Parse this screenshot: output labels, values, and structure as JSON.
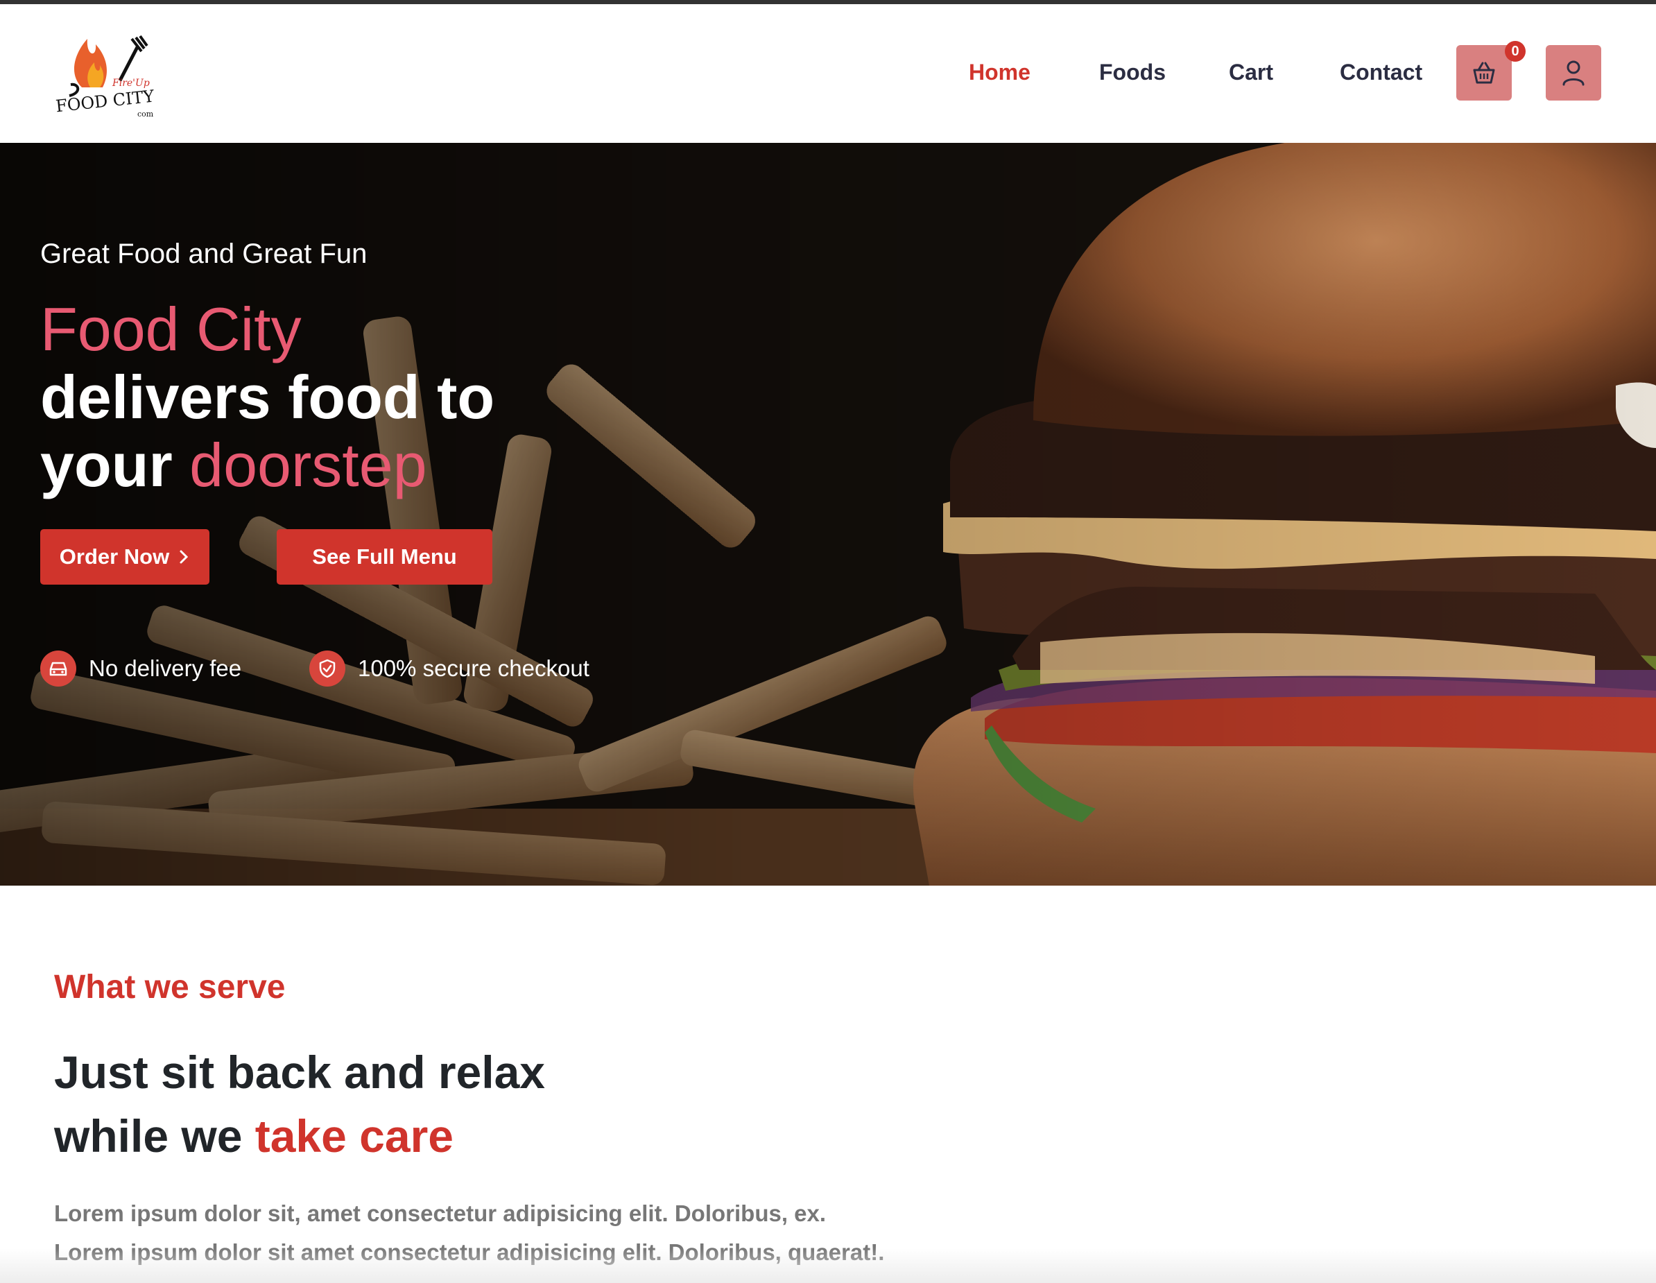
{
  "brand": {
    "logo_top": "Fire'Up",
    "logo_main": "FOOD CITY",
    "logo_sub": "com"
  },
  "nav": {
    "items": [
      {
        "label": "Home",
        "active": true
      },
      {
        "label": "Foods",
        "active": false
      },
      {
        "label": "Cart",
        "active": false
      },
      {
        "label": "Contact",
        "active": false
      }
    ],
    "cart_count": "0",
    "cart_icon": "basket-icon",
    "user_icon": "user-icon"
  },
  "hero": {
    "kicker": "Great Food and Great Fun",
    "headline_line1": "Food City",
    "headline_line2": "delivers food to",
    "headline_line3_a": "your ",
    "headline_line3_b": "doorstep",
    "order_button": "Order Now",
    "order_button_icon": "chevron-right-icon",
    "menu_button": "See Full Menu",
    "features": [
      {
        "icon": "car-icon",
        "label": "No delivery fee"
      },
      {
        "icon": "shield-check-icon",
        "label": "100% secure checkout"
      }
    ]
  },
  "serve": {
    "label": "What we serve",
    "title_line1": "Just sit back and relax",
    "title_line2_a": "while we ",
    "title_line2_b": "take care",
    "text_line1": "Lorem ipsum dolor sit, amet consectetur adipisicing elit. Doloribus, ex.",
    "text_line2": "Lorem ipsum dolor sit amet consectetur adipisicing elit. Doloribus, quaerat!."
  },
  "colors": {
    "accent": "#d0342c",
    "pink": "#e85a72",
    "icon_button": "#d98080",
    "nav_text": "#2b2d42"
  }
}
